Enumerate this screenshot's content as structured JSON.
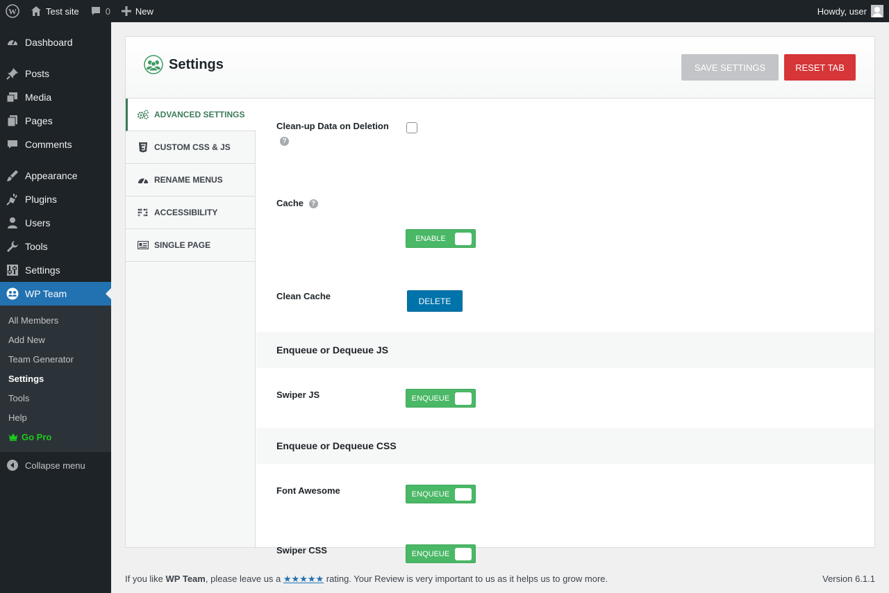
{
  "admin_bar": {
    "site_name": "Test site",
    "comments_count": "0",
    "new_label": "New",
    "greeting": "Howdy, user"
  },
  "sidebar": {
    "items": [
      {
        "label": "Dashboard",
        "icon": "dashboard-icon"
      },
      {
        "label": "Posts",
        "icon": "pushpin-icon"
      },
      {
        "label": "Media",
        "icon": "media-icon"
      },
      {
        "label": "Pages",
        "icon": "pages-icon"
      },
      {
        "label": "Comments",
        "icon": "comments-icon"
      },
      {
        "label": "Appearance",
        "icon": "paintbrush-icon"
      },
      {
        "label": "Plugins",
        "icon": "plugin-icon"
      },
      {
        "label": "Users",
        "icon": "users-icon"
      },
      {
        "label": "Tools",
        "icon": "wrench-icon"
      },
      {
        "label": "Settings",
        "icon": "settings-sliders-icon"
      },
      {
        "label": "WP Team",
        "icon": "team-icon"
      }
    ],
    "submenu": [
      {
        "label": "All Members"
      },
      {
        "label": "Add New"
      },
      {
        "label": "Team Generator"
      },
      {
        "label": "Settings"
      },
      {
        "label": "Tools"
      },
      {
        "label": "Help"
      },
      {
        "label": "Go Pro"
      }
    ],
    "collapse_label": "Collapse menu"
  },
  "panel": {
    "title": "Settings",
    "save_label": "Save Settings",
    "reset_label": "Reset Tab",
    "tabs": [
      {
        "label": "Advanced Settings",
        "icon": "gears-icon"
      },
      {
        "label": "Custom CSS & JS",
        "icon": "css3-icon"
      },
      {
        "label": "Rename Menus",
        "icon": "gauge-icon"
      },
      {
        "label": "Accessibility",
        "icon": "braille-icon"
      },
      {
        "label": "Single Page",
        "icon": "id-card-icon"
      }
    ],
    "fields": {
      "cleanup": {
        "label": "Clean-up Data on Deletion",
        "help": "?",
        "checked": false
      },
      "cache": {
        "label": "Cache",
        "help": "?",
        "toggle": "Enable"
      },
      "clean_cache": {
        "label": "Clean Cache",
        "button": "Delete"
      },
      "section_js": "Enqueue or Dequeue JS",
      "swiper_js": {
        "label": "Swiper JS",
        "toggle": "Enqueue"
      },
      "section_css": "Enqueue or Dequeue CSS",
      "font_awesome": {
        "label": "Font Awesome",
        "toggle": "Enqueue"
      },
      "swiper_css": {
        "label": "Swiper CSS",
        "toggle": "Enqueue"
      }
    }
  },
  "footer": {
    "pre": "If you like ",
    "plugin": "WP Team",
    "mid": ", please leave us a ",
    "stars": "★★★★★",
    "post": " rating. Your Review is very important to us as it helps us to grow more.",
    "version": "Version 6.1.1"
  },
  "colors": {
    "accent": "#2271b1",
    "toggle_on": "#4ab866",
    "reset": "#d63638",
    "delete": "#0073aa",
    "tab_active": "#3d7a5a"
  }
}
